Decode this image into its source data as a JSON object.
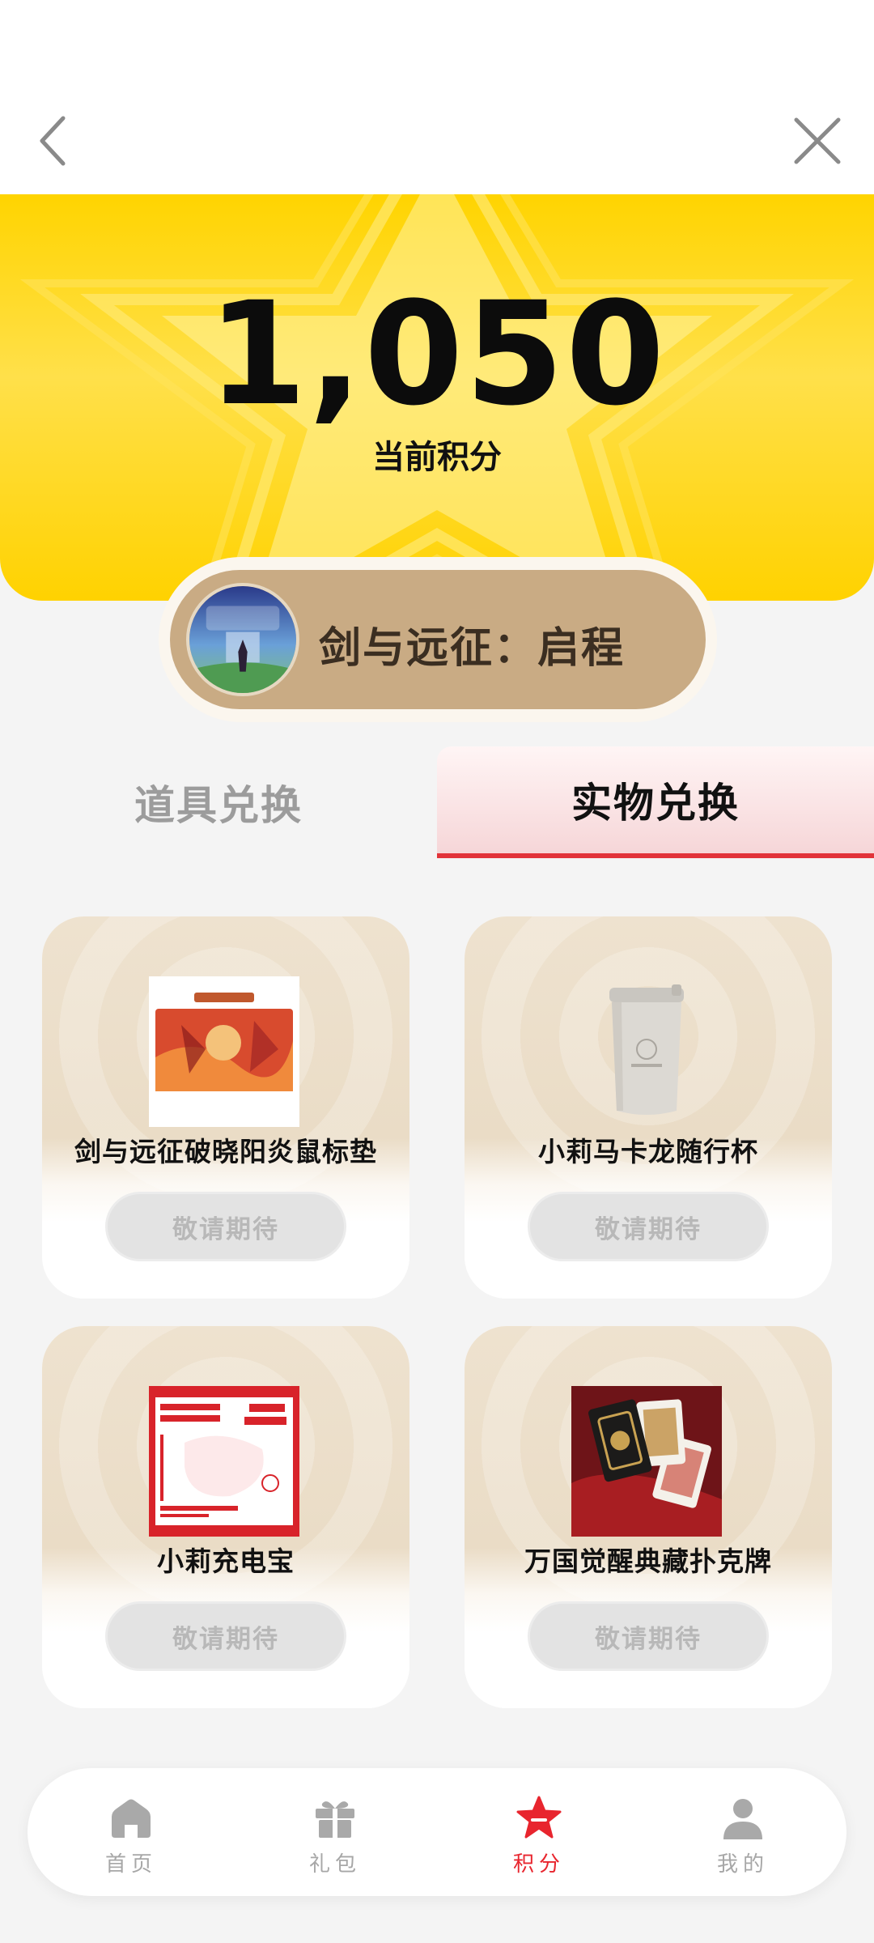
{
  "header": {
    "back_icon": "chevron-left-icon",
    "close_icon": "close-icon"
  },
  "hero": {
    "points": "1,050",
    "points_label": "当前积分",
    "background_color": "#ffd400"
  },
  "game": {
    "name": "剑与远征：启程",
    "logo_icon": "game-logo"
  },
  "tabs": [
    {
      "label": "道具兑换",
      "active": false
    },
    {
      "label": "实物兑换",
      "active": true
    }
  ],
  "products": [
    {
      "title": "剑与远征破晓阳炎鼠标垫",
      "button": "敬请期待",
      "image": "mouse-pad-image"
    },
    {
      "title": "小莉马卡龙随行杯",
      "button": "敬请期待",
      "image": "travel-cup-image"
    },
    {
      "title": "小莉充电宝",
      "button": "敬请期待",
      "image": "power-bank-image"
    },
    {
      "title": "万国觉醒典藏扑克牌",
      "button": "敬请期待",
      "image": "playing-cards-image"
    }
  ],
  "bottom_nav": [
    {
      "label": "首页",
      "icon": "home-icon",
      "active": false
    },
    {
      "label": "礼包",
      "icon": "gift-icon",
      "active": false
    },
    {
      "label": "积分",
      "icon": "star-icon",
      "active": true
    },
    {
      "label": "我的",
      "icon": "user-icon",
      "active": false
    }
  ],
  "colors": {
    "accent": "#e8252e",
    "hero_yellow": "#ffd400",
    "pill_brown": "#c9ab84"
  }
}
